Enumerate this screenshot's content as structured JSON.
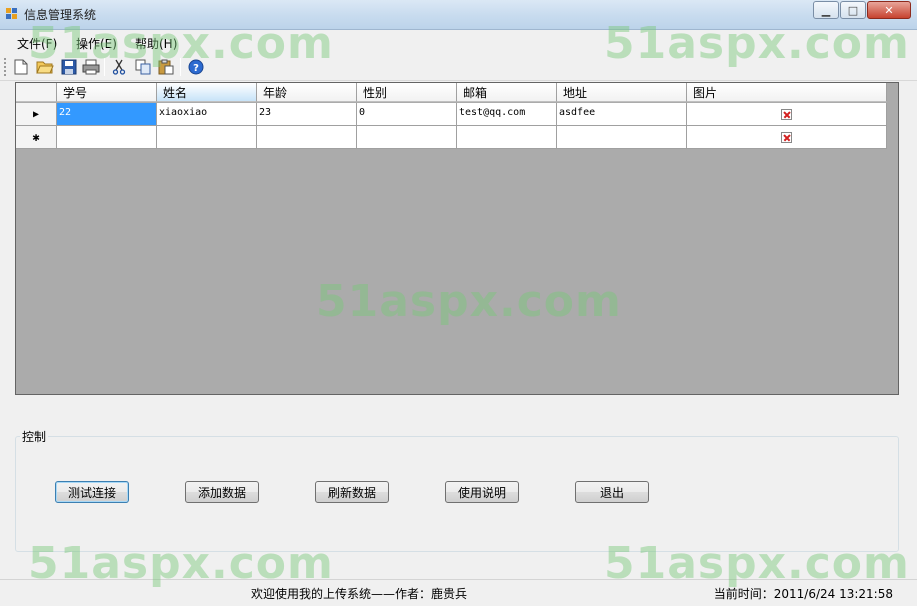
{
  "window": {
    "title": "信息管理系统",
    "minimize_label": "▁",
    "maximize_label": "□",
    "close_label": "✕"
  },
  "menu": [
    "文件(F)",
    "操作(E)",
    "帮助(H)"
  ],
  "toolbar": {
    "buttons": [
      "new-icon",
      "open-icon",
      "save-icon",
      "print-icon",
      "cut-icon",
      "copy-icon",
      "paste-icon",
      "help-icon"
    ]
  },
  "grid": {
    "columns": [
      "学号",
      "姓名",
      "年龄",
      "性别",
      "邮箱",
      "地址",
      "图片"
    ],
    "rows": [
      {
        "学号": "22",
        "姓名": "xiaoxiao",
        "年龄": "23",
        "性别": "0",
        "邮箱": "test@qq.com",
        "地址": "asdfee"
      }
    ],
    "current_row_marker": "▶",
    "new_row_marker": "✱"
  },
  "controls": {
    "group_title": "控制",
    "buttons": [
      "测试连接",
      "添加数据",
      "刷新数据",
      "使用说明",
      "退出"
    ]
  },
  "statusbar": {
    "welcome": "欢迎使用我的上传系统——作者：鹿贵兵",
    "time": "当前时间：2011/6/24 13:21:58"
  },
  "watermark": "51aspx.com",
  "colors": {
    "grid_background": "#ababab",
    "selection": "#3399ff",
    "watermark": "#78c878"
  }
}
